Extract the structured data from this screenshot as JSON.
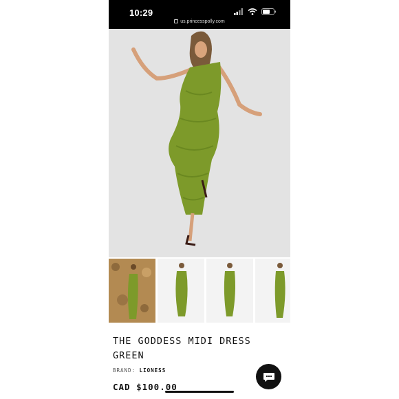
{
  "status_bar": {
    "time": "10:29",
    "url": "us.princesspolly.com"
  },
  "product": {
    "image_alt": "Model wearing The Goddess Midi Dress Green",
    "title": "THE GODDESS MIDI DRESS GREEN",
    "brand_label": "BRAND:",
    "brand_name": "LIONESS",
    "price": "CAD $100.00"
  },
  "thumbnails": [
    {
      "label": "thumbnail-1"
    },
    {
      "label": "thumbnail-2"
    },
    {
      "label": "thumbnail-3"
    },
    {
      "label": "thumbnail-4"
    }
  ],
  "colors": {
    "dress": "#7d9a2a",
    "accent": "#111111",
    "background": "#e4e4e4"
  },
  "icons": [
    "signal-icon",
    "wifi-icon",
    "battery-icon",
    "lock-icon",
    "chat-icon"
  ]
}
